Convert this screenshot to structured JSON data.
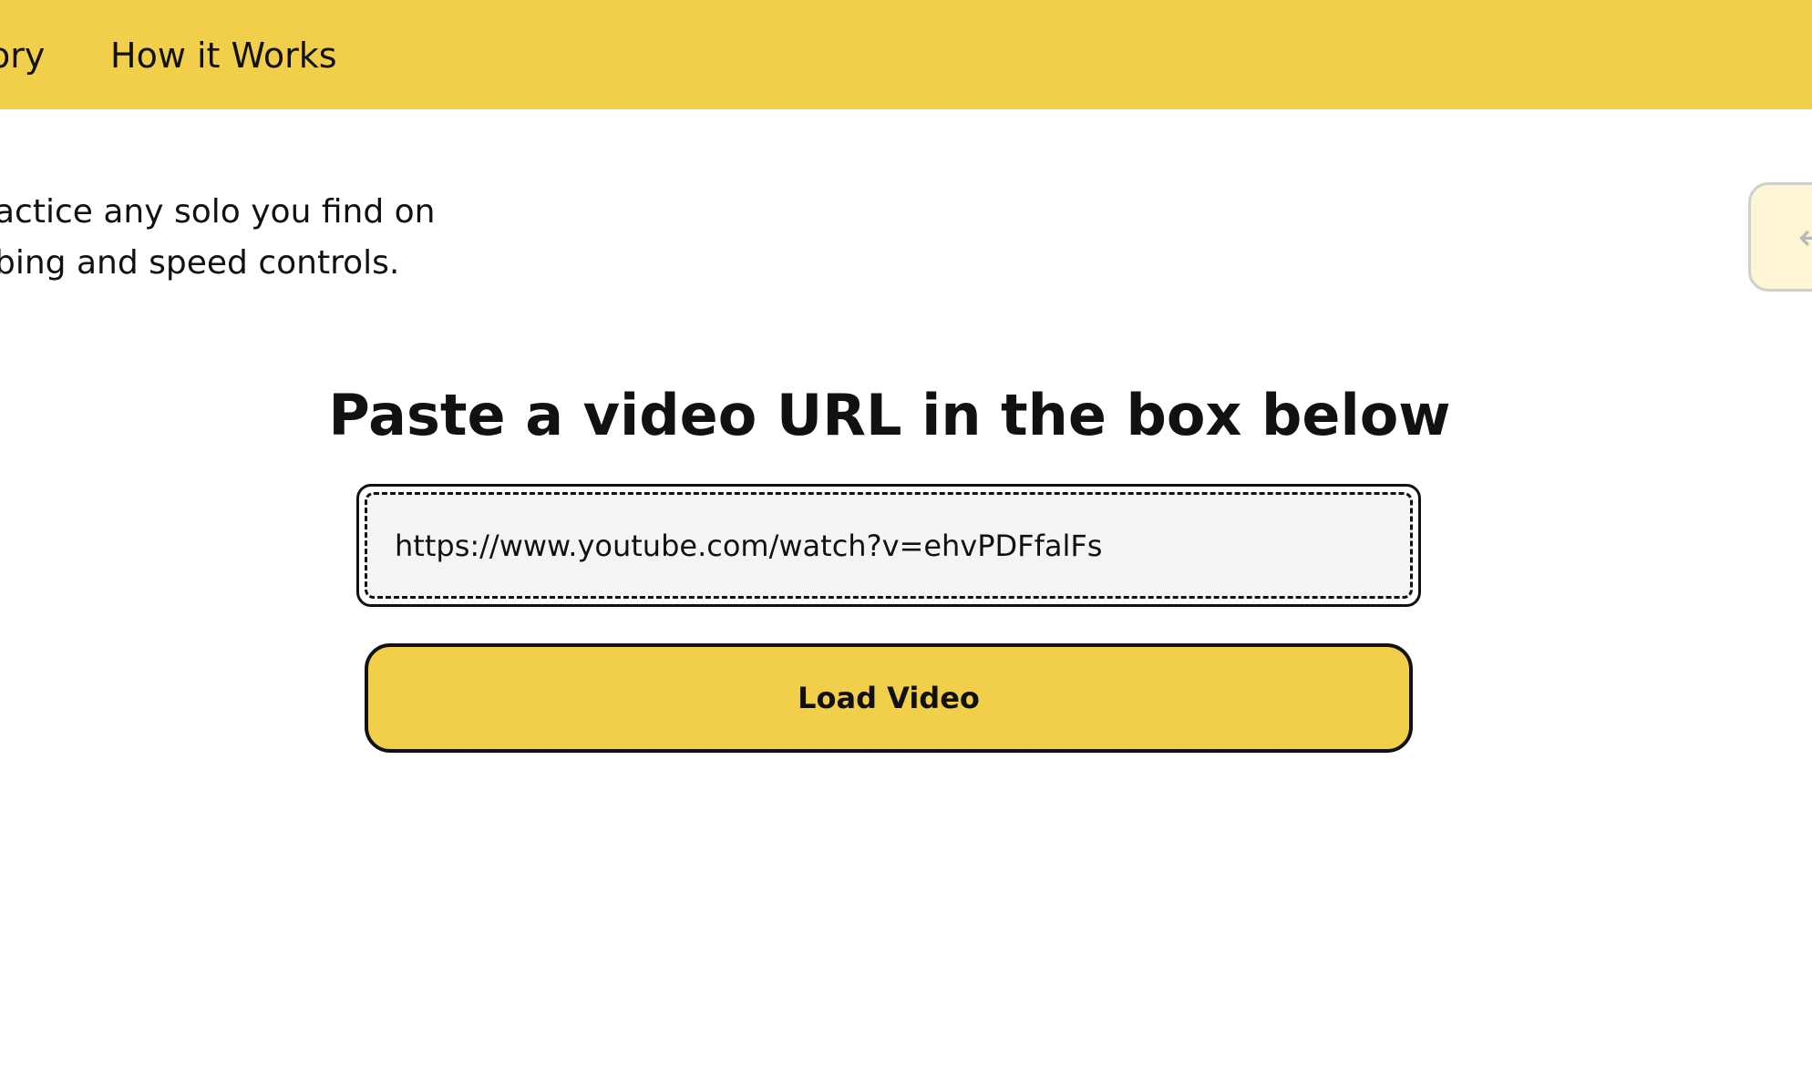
{
  "nav": {
    "items": [
      {
        "label": "ory"
      },
      {
        "label": "How it Works"
      }
    ]
  },
  "intro": {
    "line1": "actice any solo you find on",
    "line2": "bing and speed controls."
  },
  "side_tab": {
    "icon": "arrow-left-icon",
    "glyph": "←"
  },
  "main": {
    "headline": "Paste a video URL in the box below",
    "url_input": {
      "value": "https://www.youtube.com/watch?v=ehvPDFfalFs",
      "placeholder": ""
    },
    "load_button_label": "Load Video"
  },
  "colors": {
    "brand_yellow": "#f2cf4b",
    "side_tab_bg": "#fdf5d3",
    "input_bg": "#f4f4f4",
    "text": "#111111"
  }
}
